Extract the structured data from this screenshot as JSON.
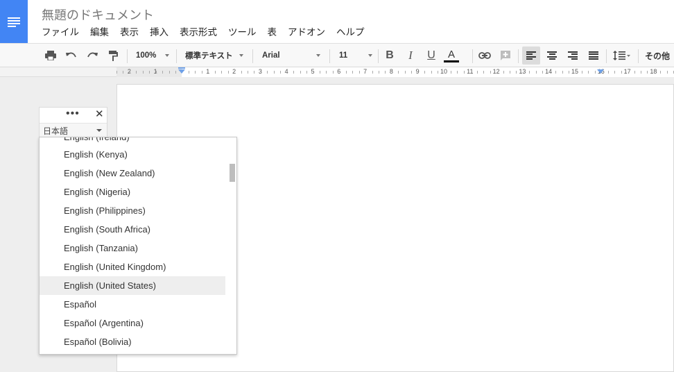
{
  "header": {
    "doc_title": "無題のドキュメント",
    "menu": [
      "ファイル",
      "編集",
      "表示",
      "挿入",
      "表示形式",
      "ツール",
      "表",
      "アドオン",
      "ヘルプ"
    ]
  },
  "toolbar": {
    "zoom": "100%",
    "style": "標準テキスト",
    "font": "Arial",
    "font_size": "11",
    "bold": "B",
    "italic": "I",
    "underline": "U",
    "text_color": "A",
    "more": "その他"
  },
  "ruler": {
    "numbers": [
      "2",
      "1",
      "1",
      "2",
      "3",
      "4",
      "5",
      "6",
      "7",
      "8",
      "9",
      "10",
      "11",
      "12",
      "13",
      "14",
      "15",
      "16",
      "17",
      "18"
    ]
  },
  "language_widget": {
    "selected": "日本語",
    "close": "✕",
    "more": "•••"
  },
  "language_list": {
    "options": [
      "English (Ireland)",
      "English (Kenya)",
      "English (New Zealand)",
      "English (Nigeria)",
      "English (Philippines)",
      "English (South Africa)",
      "English (Tanzania)",
      "English (United Kingdom)",
      "English (United States)",
      "Español",
      "Español (Argentina)",
      "Español (Bolivia)"
    ],
    "highlighted": "English (United States)"
  },
  "colors": {
    "brand": "#4285f4",
    "text_color_bar": "#000000"
  }
}
